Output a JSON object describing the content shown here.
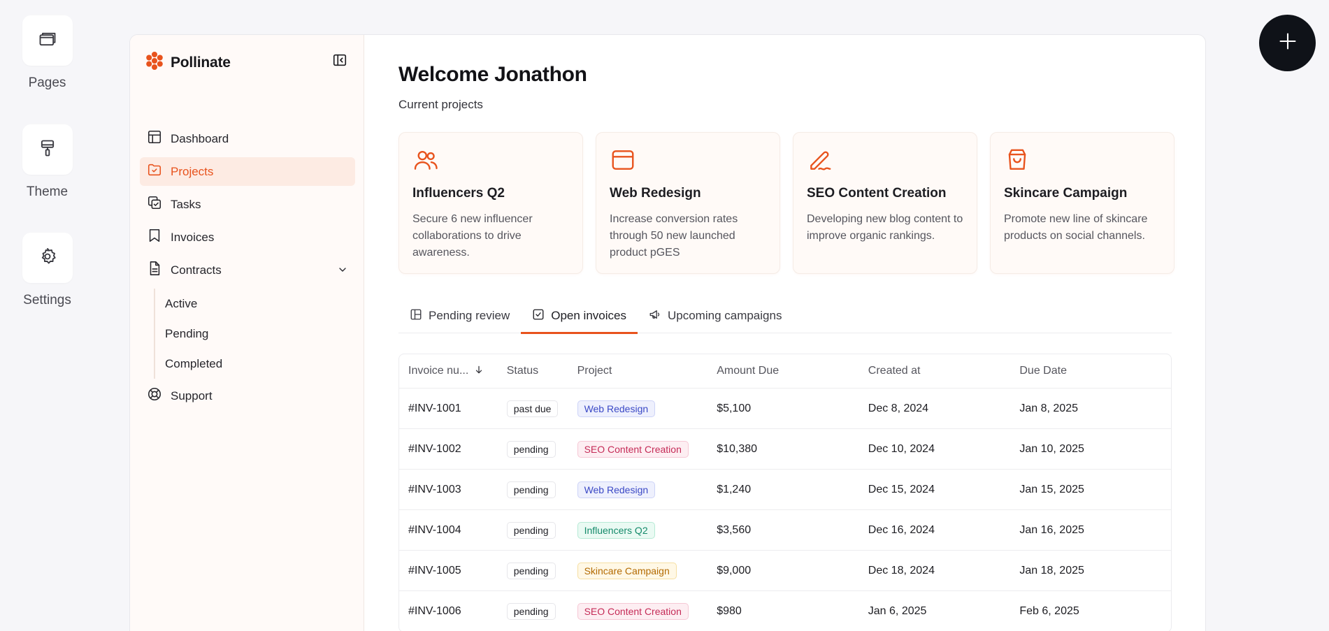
{
  "rail": {
    "items": [
      {
        "label": "Pages",
        "icon": "pages-icon"
      },
      {
        "label": "Theme",
        "icon": "paint-roller-icon"
      },
      {
        "label": "Settings",
        "icon": "gear-icon"
      }
    ]
  },
  "fab": {
    "icon": "plus-icon"
  },
  "brand": {
    "name": "Pollinate",
    "color": "#e8531d"
  },
  "sidebar": {
    "items": [
      {
        "label": "Dashboard",
        "icon": "layout-icon"
      },
      {
        "label": "Projects",
        "icon": "folder-check-icon",
        "active": true
      },
      {
        "label": "Tasks",
        "icon": "tasks-icon"
      },
      {
        "label": "Invoices",
        "icon": "bookmark-icon"
      },
      {
        "label": "Contracts",
        "icon": "document-icon"
      }
    ],
    "contracts_sub": [
      "Active",
      "Pending",
      "Completed"
    ],
    "support": {
      "label": "Support",
      "icon": "lifebuoy-icon"
    }
  },
  "main": {
    "welcome": "Welcome Jonathon",
    "subtitle": "Current projects"
  },
  "cards": [
    {
      "title": "Influencers Q2",
      "desc": "Secure 6 new influencer collaborations to drive awareness.",
      "icon": "users-icon"
    },
    {
      "title": "Web Redesign",
      "desc": "Increase conversion rates through 50 new launched product pGES",
      "icon": "browser-icon"
    },
    {
      "title": "SEO Content Creation",
      "desc": "Developing new blog content to improve organic rankings.",
      "icon": "pen-icon"
    },
    {
      "title": "Skincare Campaign",
      "desc": "Promote new line of skincare products on social channels.",
      "icon": "shopping-bag-icon"
    }
  ],
  "tabs": [
    {
      "label": "Pending review",
      "icon": "layout-icon"
    },
    {
      "label": "Open invoices",
      "icon": "checkbox-icon",
      "active": true
    },
    {
      "label": "Upcoming campaigns",
      "icon": "megaphone-icon"
    }
  ],
  "table": {
    "headers": [
      "Invoice nu...",
      "Status",
      "Project",
      "Amount Due",
      "Created at",
      "Due Date"
    ],
    "rows": [
      {
        "invoice": "#INV-1001",
        "status": "past due",
        "project": "Web Redesign",
        "amount": "$5,100",
        "created": "Dec 8, 2024",
        "due": "Jan 8, 2025"
      },
      {
        "invoice": "#INV-1002",
        "status": "pending",
        "project": "SEO Content Creation",
        "amount": "$10,380",
        "created": "Dec 10, 2024",
        "due": "Jan  10, 2025"
      },
      {
        "invoice": "#INV-1003",
        "status": "pending",
        "project": "Web Redesign",
        "amount": "$1,240",
        "created": "Dec 15, 2024",
        "due": "Jan 15, 2025"
      },
      {
        "invoice": "#INV-1004",
        "status": "pending",
        "project": "Influencers Q2",
        "amount": "$3,560",
        "created": "Dec 16, 2024",
        "due": "Jan 16, 2025"
      },
      {
        "invoice": "#INV-1005",
        "status": "pending",
        "project": "Skincare Campaign",
        "amount": "$9,000",
        "created": "Dec 18, 2024",
        "due": "Jan 18, 2025"
      },
      {
        "invoice": "#INV-1006",
        "status": "pending",
        "project": "SEO Content Creation",
        "amount": "$980",
        "created": "Jan 6, 2025",
        "due": "Feb 6, 2025"
      }
    ]
  },
  "project_colors": {
    "Web Redesign": {
      "fg": "#3b49c6",
      "bg": "#eef0fd",
      "border": "#cdd3f7"
    },
    "SEO Content Creation": {
      "fg": "#c52b57",
      "bg": "#fdeef2",
      "border": "#f6c8d5"
    },
    "Influencers Q2": {
      "fg": "#148a6a",
      "bg": "#eafaf3",
      "border": "#b6ead5"
    },
    "Skincare Campaign": {
      "fg": "#b36a00",
      "bg": "#fff8e6",
      "border": "#f6dfa2"
    }
  }
}
